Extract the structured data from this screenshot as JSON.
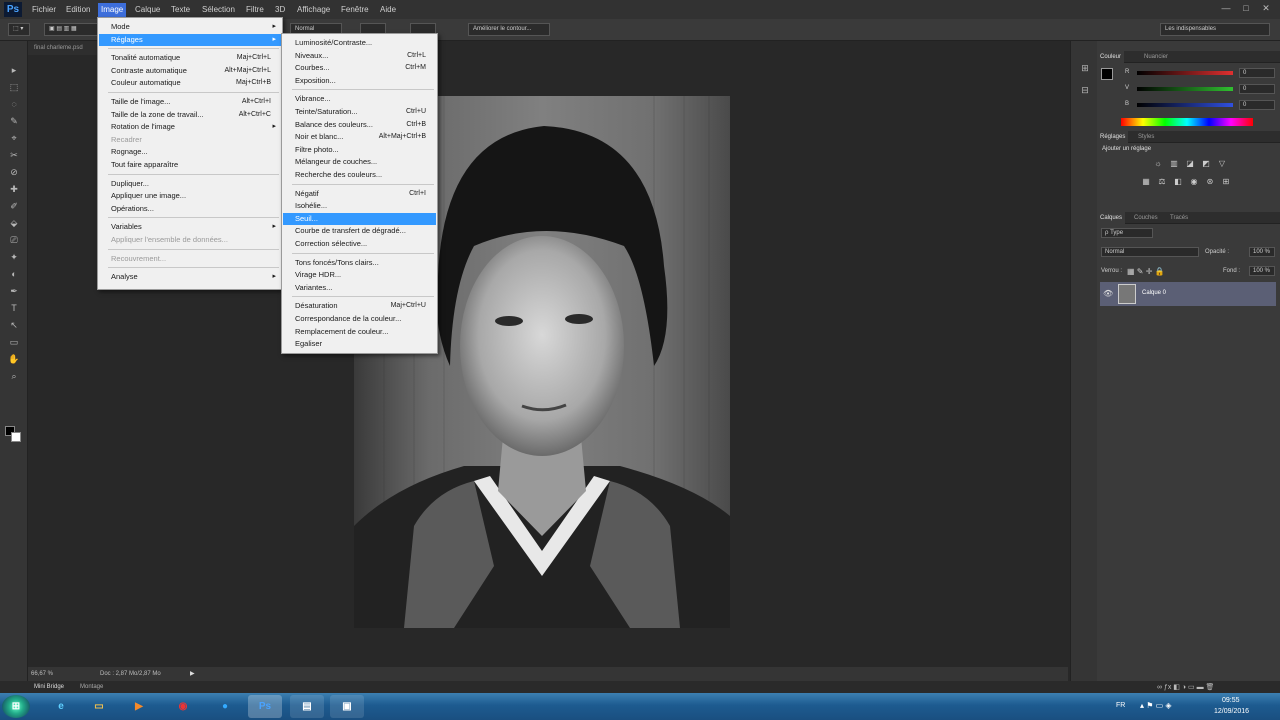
{
  "app": {
    "logo": "Ps"
  },
  "menubar": [
    "Fichier",
    "Edition",
    "Image",
    "Calque",
    "Texte",
    "Sélection",
    "Filtre",
    "3D",
    "Affichage",
    "Fenêtre",
    "Aide"
  ],
  "window_controls": [
    "—",
    "□",
    "✕"
  ],
  "options": {
    "mode": "Normal",
    "refine_edge": "Améliorer le contour...",
    "workspace": "Les indispensables"
  },
  "document": {
    "tab": "final charleme.psd",
    "zoom": "66,67 %",
    "doc_info": "Doc : 2,87 Mo/2,87 Mo"
  },
  "minibridge": {
    "tab1": "Mini Bridge",
    "tab2": "Montage"
  },
  "tools": [
    "▸",
    "⬚",
    "◌",
    "✎",
    "⌖",
    "✂",
    "⊘",
    "✚",
    "✐",
    "⬙",
    "⎚",
    "✦",
    "◐",
    "✒",
    "T",
    "↖",
    "▭",
    "✋",
    "⌕"
  ],
  "image_menu": [
    {
      "label": "Mode",
      "arrow": "▸"
    },
    {
      "label": "Réglages",
      "arrow": "▸",
      "highlight": true
    },
    {
      "sep": true
    },
    {
      "label": "Tonalité automatique",
      "shortcut": "Maj+Ctrl+L"
    },
    {
      "label": "Contraste automatique",
      "shortcut": "Alt+Maj+Ctrl+L"
    },
    {
      "label": "Couleur automatique",
      "shortcut": "Maj+Ctrl+B"
    },
    {
      "sep": true
    },
    {
      "label": "Taille de l'image...",
      "shortcut": "Alt+Ctrl+I"
    },
    {
      "label": "Taille de la zone de travail...",
      "shortcut": "Alt+Ctrl+C"
    },
    {
      "label": "Rotation de l'image",
      "arrow": "▸"
    },
    {
      "label": "Recadrer",
      "disabled": true
    },
    {
      "label": "Rognage..."
    },
    {
      "label": "Tout faire apparaître"
    },
    {
      "sep": true
    },
    {
      "label": "Dupliquer..."
    },
    {
      "label": "Appliquer une image..."
    },
    {
      "label": "Opérations..."
    },
    {
      "sep": true
    },
    {
      "label": "Variables",
      "arrow": "▸"
    },
    {
      "label": "Appliquer l'ensemble de données...",
      "disabled": true
    },
    {
      "sep": true
    },
    {
      "label": "Recouvrement...",
      "disabled": true
    },
    {
      "sep": true
    },
    {
      "label": "Analyse",
      "arrow": "▸"
    }
  ],
  "reglages_menu": [
    {
      "label": "Luminosité/Contraste..."
    },
    {
      "label": "Niveaux...",
      "shortcut": "Ctrl+L"
    },
    {
      "label": "Courbes...",
      "shortcut": "Ctrl+M"
    },
    {
      "label": "Exposition..."
    },
    {
      "sep": true
    },
    {
      "label": "Vibrance..."
    },
    {
      "label": "Teinte/Saturation...",
      "shortcut": "Ctrl+U"
    },
    {
      "label": "Balance des couleurs...",
      "shortcut": "Ctrl+B"
    },
    {
      "label": "Noir et blanc...",
      "shortcut": "Alt+Maj+Ctrl+B"
    },
    {
      "label": "Filtre photo..."
    },
    {
      "label": "Mélangeur de couches..."
    },
    {
      "label": "Recherche des couleurs..."
    },
    {
      "sep": true
    },
    {
      "label": "Négatif",
      "shortcut": "Ctrl+I"
    },
    {
      "label": "Isohélie..."
    },
    {
      "label": "Seuil...",
      "highlight": true
    },
    {
      "label": "Courbe de transfert de dégradé..."
    },
    {
      "label": "Correction sélective..."
    },
    {
      "sep": true
    },
    {
      "label": "Tons foncés/Tons clairs..."
    },
    {
      "label": "Virage HDR..."
    },
    {
      "label": "Variantes..."
    },
    {
      "sep": true
    },
    {
      "label": "Désaturation",
      "shortcut": "Maj+Ctrl+U"
    },
    {
      "label": "Correspondance de la couleur..."
    },
    {
      "label": "Remplacement de couleur..."
    },
    {
      "label": "Egaliser"
    }
  ],
  "panels": {
    "color_tabs": [
      "Couleur",
      "Nuancier"
    ],
    "channels": [
      {
        "label": "R",
        "value": "0",
        "color": "#e03030"
      },
      {
        "label": "V",
        "value": "0",
        "color": "#30c030"
      },
      {
        "label": "B",
        "value": "0",
        "color": "#3050e0"
      }
    ],
    "adjust_tabs": [
      "Réglages",
      "Styles"
    ],
    "adjust_title": "Ajouter un réglage",
    "layer_tabs": [
      "Calques",
      "Couches",
      "Tracés"
    ],
    "layer_kind": "ρ Type",
    "blend": "Normal",
    "opacity_label": "Opacité :",
    "opacity": "100 %",
    "lock_label": "Verrou :",
    "fill_label": "Fond :",
    "fill": "100 %",
    "layer_name": "Calque 0"
  },
  "taskbar": {
    "lang": "FR",
    "time": "09:55",
    "date": "12/09/2016"
  }
}
